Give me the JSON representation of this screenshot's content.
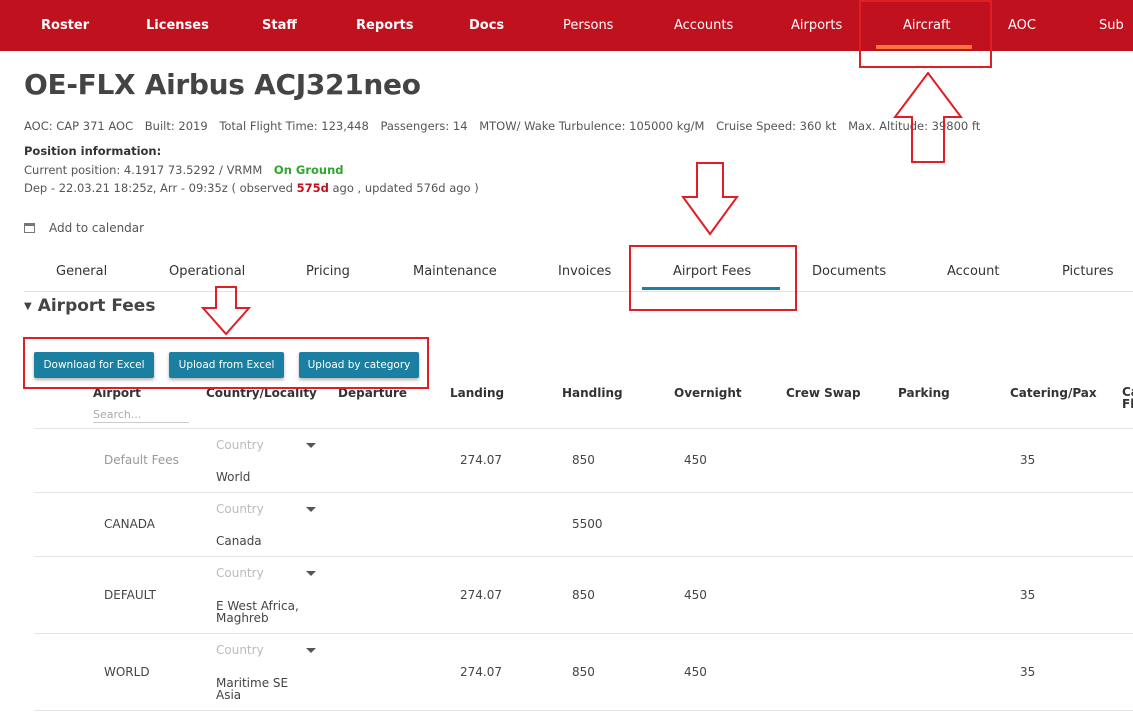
{
  "nav": {
    "items": [
      {
        "label": "Roster",
        "bold": true
      },
      {
        "label": "Licenses",
        "bold": true
      },
      {
        "label": "Staff",
        "bold": true
      },
      {
        "label": "Reports",
        "bold": true
      },
      {
        "label": "Docs",
        "bold": true
      },
      {
        "label": "Persons",
        "bold": false
      },
      {
        "label": "Accounts",
        "bold": false
      },
      {
        "label": "Airports",
        "bold": false
      },
      {
        "label": "Aircraft",
        "bold": false,
        "active": true
      },
      {
        "label": "AOC",
        "bold": false
      },
      {
        "label": "Sub",
        "bold": false
      }
    ],
    "bg_color": "#c0111f",
    "active_color": "#f5783a"
  },
  "aircraft": {
    "title": "OE-FLX Airbus ACJ321neo",
    "aoc": "AOC: CAP 371 AOC",
    "built": "Built: 2019",
    "flight_time": "Total Flight Time: 123,448",
    "passengers": "Passengers: 14",
    "mtow": "MTOW/ Wake Turbulence: 105000 kg/M",
    "cruise": "Cruise Speed: 360 kt",
    "altitude": "Max. Altitude: 39800 ft"
  },
  "position": {
    "heading": "Position information:",
    "current": "Current position: 4.1917 73.5292 / VRMM",
    "status": "On Ground",
    "dep_prefix": "Dep - 22.03.21 18:25z, Arr - 09:35z ( observed ",
    "observed_days": "575d",
    "dep_suffix": " ago , updated 576d ago )"
  },
  "calendar_label": "Add to calendar",
  "tabs": [
    "General",
    "Operational",
    "Pricing",
    "Maintenance",
    "Invoices",
    "Airport Fees",
    "Documents",
    "Account",
    "Pictures"
  ],
  "active_tab": "Airport Fees",
  "section_title": "Airport Fees",
  "buttons": {
    "download": "Download for Excel",
    "upload": "Upload from Excel",
    "category": "Upload by category"
  },
  "table": {
    "headers": [
      "Airport",
      "Country/Locality",
      "Departure",
      "Landing",
      "Handling",
      "Overnight",
      "Crew Swap",
      "Parking",
      "Catering/Pax",
      "Ca Fl"
    ],
    "search_placeholder": "Search...",
    "country_placeholder": "Country",
    "rows": [
      {
        "airport": "Default Fees",
        "muted": true,
        "country": "World",
        "landing": "274.07",
        "handling": "850",
        "overnight": "450",
        "catering": "35"
      },
      {
        "airport": "CANADA",
        "muted": false,
        "country": "Canada",
        "landing": "",
        "handling": "5500",
        "overnight": "",
        "catering": ""
      },
      {
        "airport": "DEFAULT",
        "muted": false,
        "country": "E West Africa, Maghreb",
        "landing": "274.07",
        "handling": "850",
        "overnight": "450",
        "catering": "35"
      },
      {
        "airport": "WORLD",
        "muted": false,
        "country": "Maritime SE Asia",
        "landing": "274.07",
        "handling": "850",
        "overnight": "450",
        "catering": "35"
      }
    ]
  },
  "annotation_color": "#e01e25"
}
